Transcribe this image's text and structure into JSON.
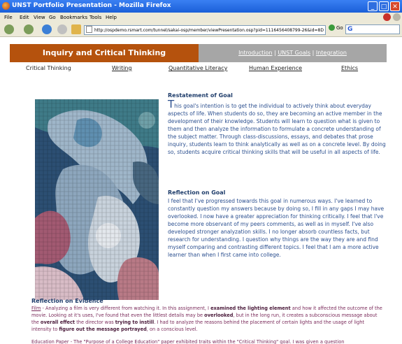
{
  "window": {
    "title": "UNST Portfolio Presentation - Mozilla Firefox",
    "buttons": {
      "minimize": "_",
      "maximize": "□",
      "close": "✕"
    }
  },
  "menubar": {
    "file": "File",
    "edit": "Edit",
    "view": "View",
    "go": "Go",
    "bookmarks": "Bookmarks",
    "tools": "Tools",
    "help": "Help"
  },
  "toolbar": {
    "url": "http://ospdemo.rsmart.com/tunnel/sakai-osp/member/viewPresentation.osp?pid=1116456408799-26&id=8D",
    "go_label": "Go",
    "search_value": ""
  },
  "page": {
    "banner_title": "Inquiry and Critical Thinking",
    "top_links": [
      "Introduction",
      "UNST Goals",
      "Integration"
    ],
    "top_link_sep": "|",
    "subnav": [
      "Critical Thinking",
      "Writing",
      "Quantitative Literacy",
      "Human Experience",
      "Ethics"
    ],
    "restatement_heading": "Restatement of Goal",
    "restatement_dropcap": "T",
    "restatement_text": "his goal's intention is to get the individual to actively think about everyday aspects of life. When students do so, they are becoming an active member in the development of their knowledge. Students will learn to question what is given to them and then analyze the information to formulate a concrete understanding of the subject matter. Through class-discussions, essays, and debates that prose inquiry, students learn to think analytically as well as on a concrete level. By doing so, students acquire critical thinking skills that will be useful in all aspects of life.",
    "reflection_heading": "Reflection on Goal",
    "reflection_text": "I feel that I've progressed towards this goal in numerous ways. I've learned to constantly question my answers because by doing so, I fill in any gaps I may have overlooked. I now have a greater appreciation for thinking critically. I feel that I've become more observant of my peers comments, as well as in myself. I've also developed stronger analyzation skills. I no longer absorb countless facts, but research for understanding. I question why things are the way they are and find myself comparing and contrasting different topics. I feel that I am a more active learner than when I first came into college.",
    "evidence_heading": "Reflection on Evidence",
    "evidence_film_label": "Film",
    "evidence_film_parts": [
      " - Analyzing a film is very different from watching it. In this assignment, I ",
      "examined the lighting element",
      " and how it affected the outcome of the movie. Looking at it's uses, I've found that even the littlest details may be ",
      "overlooked",
      ", but in the long run, it creates a subconscious message about the ",
      "overall effect",
      " the director was ",
      "trying to instill",
      ". I had to analyze the reasons behind the placement of certain lights and the usage of light intensity to ",
      "figure out the message portrayed",
      ", on a conscious level."
    ],
    "evidence_paper_text": "Education Paper - The \"Purpose of a College Education\" paper exhibited traits within the \"Critical Thinking\" goal. I was given a question"
  },
  "colors": {
    "banner": "#b5520d",
    "band": "#a6a6a6",
    "heading": "#1f3d6b",
    "body_text": "#2b4f8f",
    "evidence_text": "#7a2a5a"
  }
}
